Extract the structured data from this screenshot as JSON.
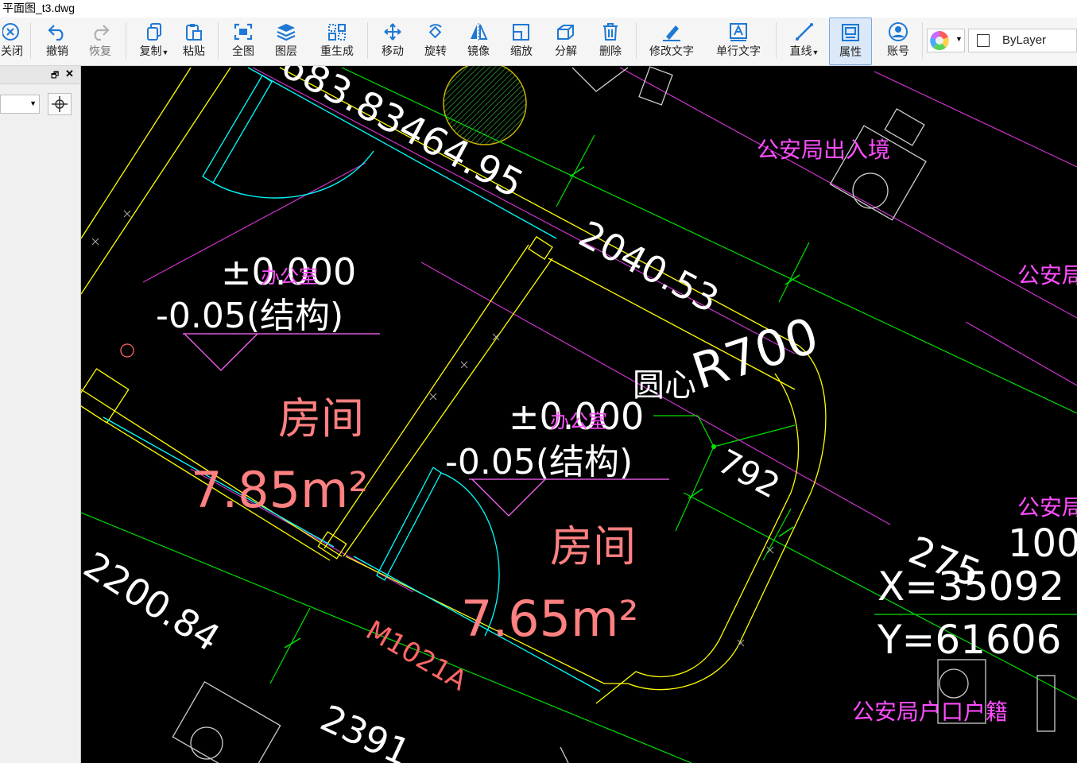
{
  "window": {
    "title": "平面图_t3.dwg"
  },
  "toolbar": {
    "close": "关闭",
    "undo": "撤销",
    "redo": "恢复",
    "copy": "复制",
    "paste": "粘贴",
    "fit": "全图",
    "layers": "图层",
    "regen": "重生成",
    "move": "移动",
    "rotate": "旋转",
    "mirror": "镜像",
    "scale": "缩放",
    "explode": "分解",
    "delete": "删除",
    "edit_text": "修改文字",
    "single_text": "单行文字",
    "line": "直线",
    "properties": "属性",
    "account": "账号",
    "layer_value": "ByLayer"
  },
  "drawing": {
    "dim_top": "683.83464.95",
    "dim_2040": "2040.53",
    "radius": "R700",
    "center": "圆心",
    "dim_792": "792",
    "level_left": "±0.000",
    "level_left_struct": "-0.05(结构)",
    "office_left": "办公室",
    "room_left": "房间",
    "area_left": "7.85m²",
    "level_right": "±0.000",
    "level_right_struct": "-0.05(结构)",
    "office_right": "办公室",
    "room_right": "房间",
    "area_right": "7.65m²",
    "door": "M1021A",
    "dim_2200": "2200.84",
    "dim_2391": "2391",
    "dim_275": "275",
    "dim_100": "100",
    "coord_x": "X=35092",
    "coord_y": "Y=61606",
    "label_exit_entry": "公安局出入境",
    "label_psb1": "公安局",
    "label_psb2": "公安局",
    "label_household": "公安局户口户籍"
  },
  "colors": {
    "background": "#000000",
    "white": "#ffffff",
    "yellow": "#ffff00",
    "cyan": "#00ffff",
    "green": "#00ff00",
    "magenta": "#ff00ff",
    "red_text": "#ff8080",
    "pink_text": "#ff4dff"
  }
}
